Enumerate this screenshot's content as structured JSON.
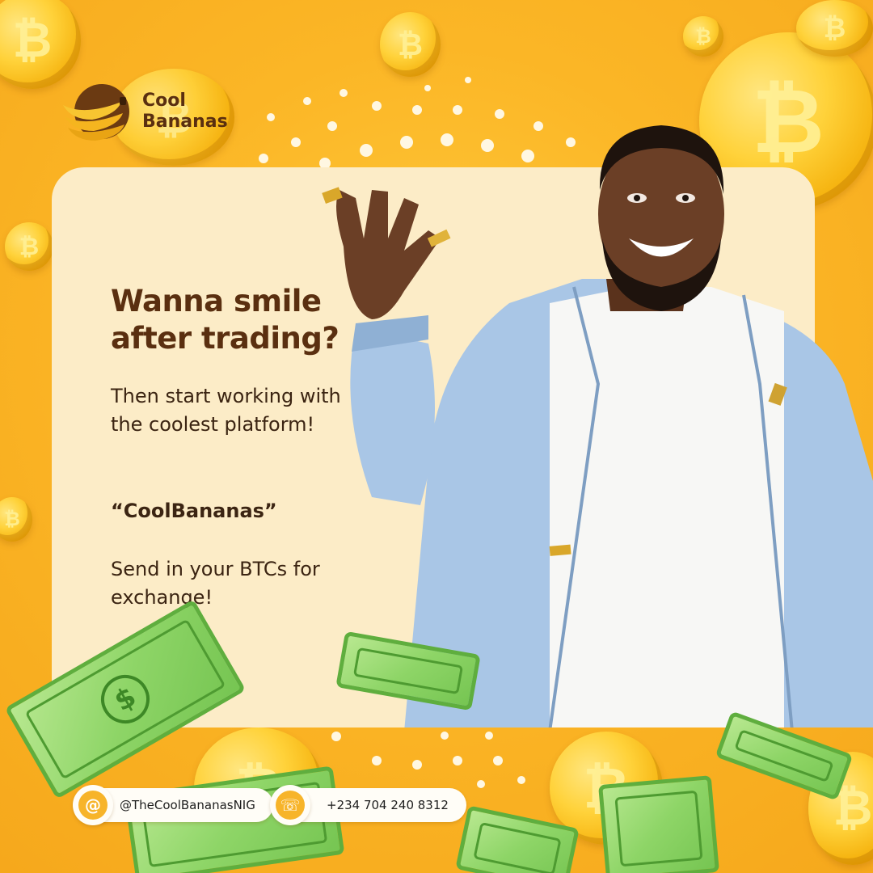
{
  "brand": {
    "name_line1": "Cool",
    "name_line2": "Bananas",
    "logo_icon": "banana-bunch-icon"
  },
  "headline": "Wanna smile after trading?",
  "body": {
    "intro": "Then start working with the coolest platform!",
    "brand_quote": "“CoolBananas”",
    "cta": "Send in your BTCs for exchange!"
  },
  "contacts": [
    {
      "icon": "at-sign-icon",
      "glyph": "@",
      "text": "@TheCoolBananasNIG"
    },
    {
      "icon": "phone-icon",
      "glyph": "☏",
      "text": "+234 704 240 8312"
    }
  ],
  "decorations": {
    "coin_symbol": "₿",
    "bill_symbol": "$"
  },
  "colors": {
    "background": "#FBB626",
    "card": "#FCECC7",
    "headline": "#5A2F10",
    "money_green": "#8ED567"
  }
}
